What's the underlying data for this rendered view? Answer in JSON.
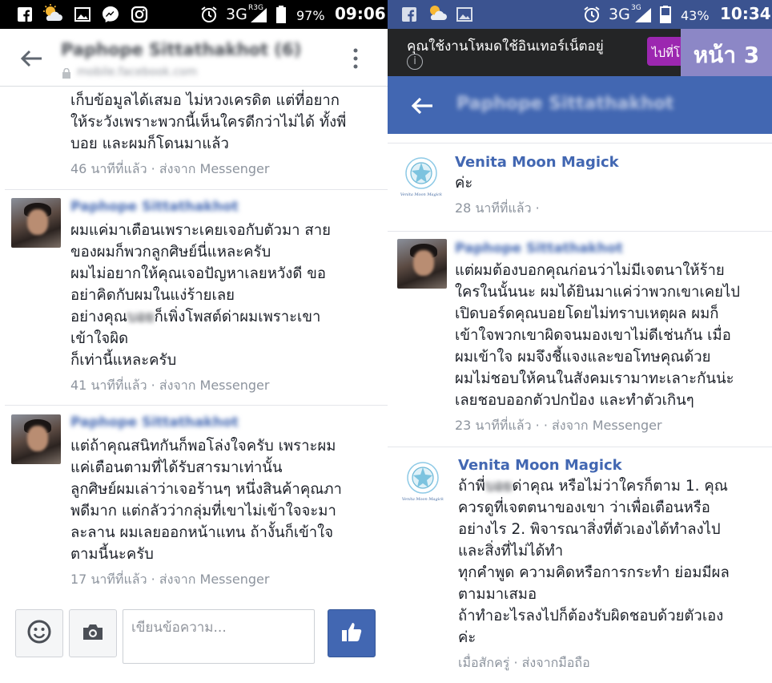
{
  "left": {
    "status": {
      "network": "3G",
      "network_sub": "R3G",
      "battery": "97%",
      "time": "09:06"
    },
    "header": {
      "title": "Paphope Sittathakhot (6)",
      "subtitle": "mobile.facebook.com"
    },
    "messages": [
      {
        "text": "เก็บข้อมูลได้เสมอ ไม่หวงเครดิต แต่ที่อยาก\nให้ระวังเพราะพวกนี้เห็นใครดีกว่าไม่ได้ ทั้งพี่\nบอย และผมก็โดนมาแล้ว",
        "meta": "46 นาทีที่แล้ว · ส่งจาก Messenger"
      },
      {
        "sender": "Paphope Sittathakhot",
        "text": "ผมแค่มาเตือนเพราะเคยเจอกับตัวมา สาย\nของผมก็พวกลูกศิษย์นี่แหละครับ\nผมไม่อยากให้คุณเจอปัญหาเลยหวังดี ขอ\nอย่าคิดกับผมในแง่ร้ายเลย",
        "text_a": "อย่างคุณ",
        "text_hidden": "บอย",
        "text_b": "ก็เพิ่งโพสต์ด่าผมเพราะเขา\nเข้าใจผิด\nก็เท่านี้แหละครับ",
        "meta": "41 นาทีที่แล้ว · ส่งจาก Messenger"
      },
      {
        "sender": "Paphope Sittathakhot",
        "text": "แต่ถ้าคุณสนิทกันก็พอโล่งใจครับ เพราะผม\nแค่เตือนตามที่ได้รับสารมาเท่านั้น\nลูกศิษย์ผมเล่าว่าเจอร้านๆ หนึ่งสินค้าคุณภา\nพดีมาก แต่กลัวว่ากลุ่มที่เขาไม่เข้าใจจะมา\nละลาน ผมเลยออกหน้าแทน ถ้างั้นก็เข้าใจ\nตามนี้นะครับ",
        "meta": "17 นาทีที่แล้ว · ส่งจาก Messenger"
      }
    ],
    "composer": {
      "placeholder": "เขียนข้อความ..."
    }
  },
  "right": {
    "status": {
      "network": "3G",
      "network_sub": "3G",
      "battery": "43%",
      "time": "10:34"
    },
    "databar": {
      "text": "คุณใช้งานโหมดใช้อินเทอร์เน็ตอยู่",
      "button": "ไปที่โ",
      "info": "i"
    },
    "badge": "หน้า 3",
    "header": {
      "title": "Paphope Sittathakhot"
    },
    "messages": [
      {
        "sender": "Venita Moon Magick",
        "text": "ค่ะ",
        "meta": "28 นาทีที่แล้ว ·"
      },
      {
        "sender": "Paphope Sittathakhot",
        "text": "แต่ผมต้องบอกคุณก่อนว่าไม่มีเจตนาให้ร้าย\nใครในนั้นนะ ผมได้ยินมาแค่ว่าพวกเขาเคยไป\nเปิดบอร์ดคุณบอยโดยไม่ทราบเหตุผล ผมก็\nเข้าใจพวกเขาผิดจนมองเขาไม่ดีเช่นกัน เมื่อ\nผมเข้าใจ ผมจึงชี้แจงและขอโทษคุณด้วย\nผมไม่ชอบให้คนในสังคมเรามาทะเลาะกันน่ะ\nเลยชอบออกตัวปกป้อง และทำตัวเกินๆ",
        "meta": "23 นาทีที่แล้ว · · ส่งจาก Messenger"
      },
      {
        "sender": "Venita Moon Magick",
        "text_a": "ถ้าพี่",
        "text_hidden": "บอย",
        "text_b": "ด่าคุณ หรือไม่ว่าใครก็ตาม 1. คุณ\nควรดูที่เจตตนาของเขา ว่าเพื่อเตือนหรือ\nอย่างไร 2. พิจารณาสิ่งที่ตัวเองได้ทำลงไป\nและสิ่งที่ไม่ได้ทำ\nทุกคำพูด ความคิดหรือการกระทำ ย่อมมีผล\nตามมาเสมอ\nถ้าทำอะไรลงไปก็ต้องรับผิดชอบด้วยตัวเอง\nค่ะ",
        "meta": "เมื่อสักครู่ · ส่งจากมือถือ"
      }
    ],
    "logo_text": "Venita Moon Magick"
  },
  "colors": {
    "fb_blue": "#4267b2",
    "status_dark": "#000000",
    "status_blue": "#3b5390",
    "badge": "#8c87c6",
    "databar": "#242526",
    "data_button": "#9c27b0"
  }
}
